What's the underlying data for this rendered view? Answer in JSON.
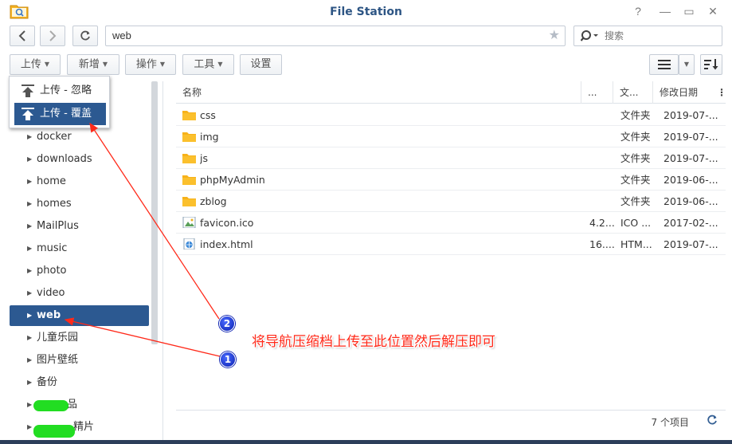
{
  "window": {
    "title": "File Station",
    "help": "?",
    "minimize": "—",
    "maximize": "▭",
    "close": "✕"
  },
  "nav": {
    "path": "web",
    "search_placeholder": "搜索"
  },
  "toolbar": {
    "upload": "上传",
    "new": "新增",
    "action": "操作",
    "tools": "工具",
    "settings": "设置"
  },
  "upload_menu": {
    "items": [
      {
        "label": "上传 - 忽略"
      },
      {
        "label": "上传 - 覆盖"
      }
    ]
  },
  "sidebar": {
    "items": [
      {
        "label": "docker"
      },
      {
        "label": "downloads"
      },
      {
        "label": "home"
      },
      {
        "label": "homes"
      },
      {
        "label": "MailPlus"
      },
      {
        "label": "music"
      },
      {
        "label": "photo"
      },
      {
        "label": "video"
      },
      {
        "label": "web"
      },
      {
        "label": "儿童乐园"
      },
      {
        "label": "图片壁纸"
      },
      {
        "label": "备份"
      },
      {
        "label": "品"
      },
      {
        "label": "精片"
      }
    ],
    "selected": "web"
  },
  "file_list": {
    "columns": [
      "名称",
      "...",
      "文...",
      "修改日期"
    ],
    "rows": [
      {
        "name": "css",
        "size": "",
        "type": "文件夹",
        "date": "2019-07-..."
      },
      {
        "name": "img",
        "size": "",
        "type": "文件夹",
        "date": "2019-07-..."
      },
      {
        "name": "js",
        "size": "",
        "type": "文件夹",
        "date": "2019-07-..."
      },
      {
        "name": "phpMyAdmin",
        "size": "",
        "type": "文件夹",
        "date": "2019-06-..."
      },
      {
        "name": "zblog",
        "size": "",
        "type": "文件夹",
        "date": "2019-06-..."
      },
      {
        "name": "favicon.ico",
        "size": "4.2...",
        "type": "ICO ...",
        "date": "2017-02-..."
      },
      {
        "name": "index.html",
        "size": "16....",
        "type": "HTM...",
        "date": "2019-07-..."
      }
    ],
    "status": "7 个项目"
  },
  "annotation": {
    "text": "将导航压缩档上传至此位置然后解压即可",
    "badge_1": "1",
    "badge_2": "2",
    "color": "#ff2a1a"
  },
  "colors": {
    "accent": "#2c5991",
    "title": "#2d5584",
    "folder": "#f7b21a"
  }
}
